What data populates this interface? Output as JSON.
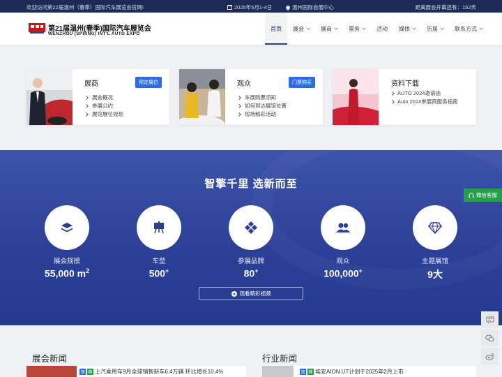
{
  "topbar": {
    "welcome": "欢迎访问第22届温州（春季）国际汽车展览会官网!",
    "date": "2025年5月1-4日",
    "venue": "温州国际会展中心",
    "countdown": "距离展会开幕还有：152天"
  },
  "header": {
    "logo_cn": "第21届温州(春季)国际汽车展览会",
    "logo_en": "WENZHOU (SPRING) INT'L AUTO EXPO",
    "nav": [
      {
        "label": "首页",
        "dropdown": false,
        "active": true
      },
      {
        "label": "展会",
        "dropdown": true
      },
      {
        "label": "展商",
        "dropdown": true
      },
      {
        "label": "票务",
        "dropdown": true
      },
      {
        "label": "活动",
        "dropdown": false
      },
      {
        "label": "媒体",
        "dropdown": true
      },
      {
        "label": "历届",
        "dropdown": true
      },
      {
        "label": "联系方式",
        "dropdown": true
      }
    ]
  },
  "cards": [
    {
      "title": "展商",
      "badge": "预定展位",
      "items": [
        "展会概况",
        "参展公约",
        "展馆展位规划"
      ]
    },
    {
      "title": "观众",
      "badge": "门票购买",
      "items": [
        "车展购票须知",
        "如何到达展馆位置",
        "现场精彩活动"
      ]
    },
    {
      "title": "资料下载",
      "items": [
        "AUTO 2024邀请函",
        "Auto 2024参展商服务指南"
      ]
    }
  ],
  "banner": {
    "slogan": "智擎千里 选新而至",
    "stats": [
      {
        "icon": "layers-icon",
        "label": "展会规模",
        "value": "55,000 m",
        "sup": "2"
      },
      {
        "icon": "easel-icon",
        "label": "车型",
        "value": "500",
        "sup": "+"
      },
      {
        "icon": "diamond-grid-icon",
        "label": "参展品牌",
        "value": "80",
        "sup": "+"
      },
      {
        "icon": "users-icon",
        "label": "观众",
        "value": "100,000",
        "sup": "+"
      },
      {
        "icon": "gem-icon",
        "label": "主题展馆",
        "value": "9大",
        "sup": ""
      }
    ],
    "video_button": "观看精彩视频"
  },
  "side": {
    "wechat_service": "微信客服"
  },
  "news": {
    "expo_heading": "展会新闻",
    "industry_heading": "行业新闻",
    "expo_items": [
      {
        "title": "上汽乘用车9月全球销售新车6.4万辆 环比增长10.4%",
        "tags": [
          "顶",
          "荐"
        ]
      }
    ],
    "industry_items": [
      {
        "title": "埃安AION UT计划于2025年2月上市",
        "tags": [
          "顶",
          "荐"
        ]
      }
    ]
  },
  "colors": {
    "topbar": "#1e2a55",
    "banner": "#2b3f97",
    "accent_blue": "#2c6de1",
    "wechat_green": "#22a04a"
  }
}
